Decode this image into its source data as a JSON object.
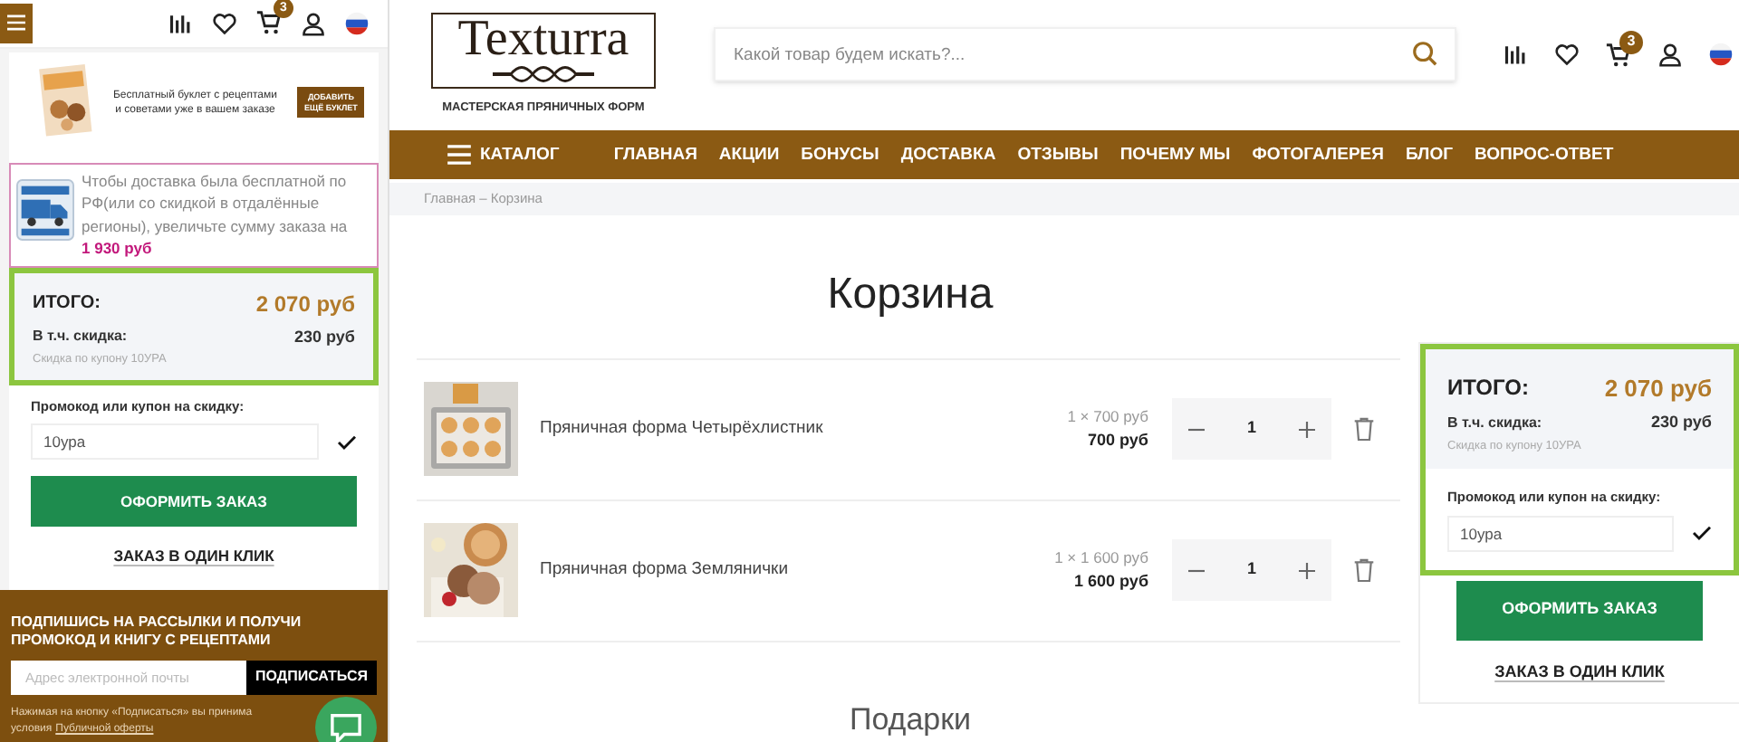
{
  "mobile": {
    "cart_badge": "3",
    "booklet": {
      "text": "Бесплатный буклет с рецептами и советами уже в вашем заказе",
      "button": "ДОБАВИТЬ ЕЩЁ БУКЛЕТ"
    },
    "delivery_notice": {
      "text": "Чтобы доставка была бесплатной по РФ(или со скидкой в отдалённые регионы), увеличьте сумму заказа на",
      "amount": "1 930 руб"
    },
    "summary": {
      "total_label": "ИТОГО:",
      "total": "2 070 руб",
      "discount_label": "В т.ч. скидка:",
      "discount": "230 руб",
      "coupon_note": "Скидка по купону 10УРА"
    },
    "promo": {
      "label": "Промокод или купон на скидку:",
      "value": "10ура",
      "applied": true
    },
    "checkout_button": "ОФОРМИТЬ ЗАКАЗ",
    "one_click_link": "ЗАКАЗ В ОДИН КЛИК",
    "subscribe": {
      "title": "ПОДПИШИСЬ НА РАССЫЛКИ И ПОЛУЧИ ПРОМОКОД И КНИГУ С РЕЦЕПТАМИ",
      "placeholder": "Адрес электронной почты",
      "button": "ПОДПИСАТЬСЯ",
      "note": "Нажимая на кнопку «Подписаться» вы принима",
      "note_2": "условия",
      "note_link": "Публичной оферты"
    }
  },
  "desktop": {
    "logo": {
      "name": "Texturra",
      "tagline": "МАСТЕРСКАЯ ПРЯНИЧНЫХ ФОРМ"
    },
    "search": {
      "placeholder": "Какой товар будем искать?..."
    },
    "cart_badge": "3",
    "catalog": "КАТАЛОГ",
    "nav": [
      "ГЛАВНАЯ",
      "АКЦИИ",
      "БОНУСЫ",
      "ДОСТАВКА",
      "ОТЗЫВЫ",
      "ПОЧЕМУ МЫ",
      "ФОТОГАЛЕРЕЯ",
      "БЛОГ",
      "ВОПРОС-ОТВЕТ"
    ],
    "breadcrumb": "Главная – Корзина",
    "heading": "Корзина",
    "items": [
      {
        "name": "Пряничная форма Четырёхлистник",
        "unit_price": "1 × 700 руб",
        "total": "700 руб",
        "quantity": "1"
      },
      {
        "name": "Пряничная форма Землянички",
        "unit_price": "1 × 1 600 руб",
        "total": "1 600 руб",
        "quantity": "1"
      }
    ],
    "gifts_heading": "Подарки",
    "summary": {
      "total_label": "ИТОГО:",
      "total": "2 070 руб",
      "discount_label": "В т.ч. скидка:",
      "discount": "230 руб",
      "coupon_note": "Скидка по купону 10УРА"
    },
    "promo": {
      "label": "Промокод или купон на скидку:",
      "value": "10ура",
      "applied": true
    },
    "checkout_button": "ОФОРМИТЬ ЗАКАЗ",
    "one_click_link": "ЗАКАЗ В ОДИН КЛИК"
  }
}
